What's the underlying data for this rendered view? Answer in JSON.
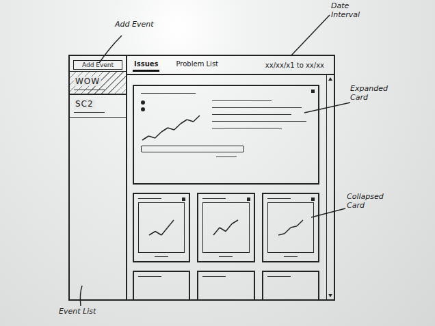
{
  "annotations": [
    {
      "text": "Add Event"
    },
    {
      "text": "Date\nInterval"
    },
    {
      "text": "Expanded\nCard"
    },
    {
      "text": "Collapsed\nCard"
    },
    {
      "text": "Event List"
    }
  ],
  "sidebar": {
    "button": "Add Event",
    "items": [
      {
        "label": "WOW",
        "selected": true
      },
      {
        "label": "SC2",
        "selected": false
      }
    ]
  },
  "tabs": [
    {
      "label": "Issues",
      "selected": true
    },
    {
      "label": "Problem List",
      "selected": false
    }
  ],
  "date_range": "xx/xx/x1 to xx/xx",
  "expanded_card": {
    "series": [
      1,
      2,
      1.5,
      3,
      4,
      3.5,
      5,
      6,
      5.5,
      7
    ]
  },
  "collapsed_cards": [
    {
      "series": [
        2,
        2.5,
        2,
        3,
        4
      ]
    },
    {
      "series": [
        2,
        3,
        2.5,
        3.5,
        4
      ]
    },
    {
      "series": [
        2,
        2.2,
        3,
        3.2,
        4
      ]
    }
  ],
  "partial_cards": [
    {},
    {},
    {}
  ]
}
